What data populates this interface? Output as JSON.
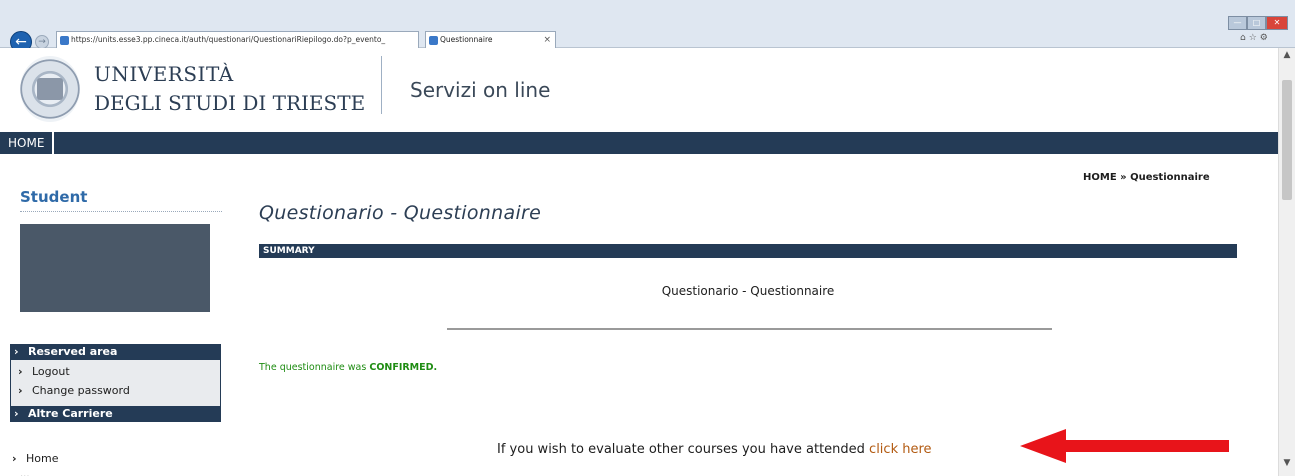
{
  "browser": {
    "url": "https://units.esse3.pp.cineca.it/auth/questionari/QuestionariRiepilogo.do?p_evento_",
    "tab_title": "Questionnaire",
    "back_icon": "back-arrow-icon",
    "close_tab_glyph": "×",
    "window_controls": [
      "—",
      "□",
      "✕"
    ]
  },
  "header": {
    "university_line1": "UNIVERSITÀ",
    "university_line2": "DEGLI STUDI DI TRIESTE",
    "services_title": "Servizi on line"
  },
  "navbar": {
    "home_label": "HOME"
  },
  "breadcrumb": "HOME » Questionnaire",
  "sidebar": {
    "title": "Student",
    "reserved_area_label": "Reserved area",
    "reserved_items": [
      "Logout",
      "Change password"
    ],
    "altre_carriere_label": "Altre Carriere",
    "home_label": "Home",
    "cutoff_label": "..."
  },
  "main": {
    "page_title": "Questionario - Questionnaire",
    "summary_label": "SUMMARY",
    "summary_heading": "Questionario - Questionnaire",
    "status_prefix": "The questionnaire was ",
    "status_value": "CONFIRMED.",
    "eval_prefix": "If you wish to evaluate other courses you have attended ",
    "eval_link": "click here"
  },
  "colors": {
    "navy": "#243b56",
    "link": "#b25a11",
    "status_green": "#1e8c12",
    "annotation_red": "#e8141a"
  }
}
